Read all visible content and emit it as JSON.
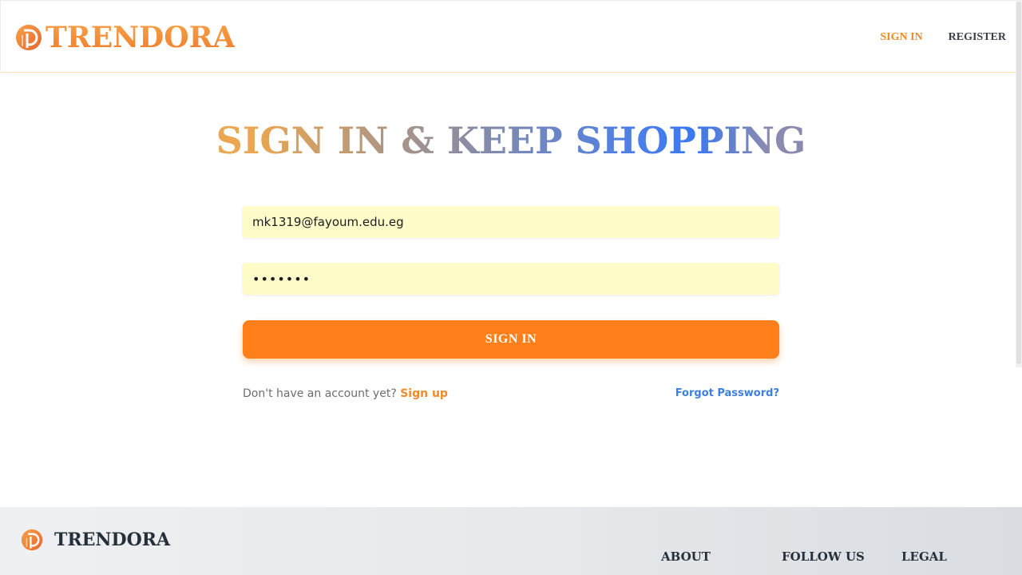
{
  "brand": {
    "name": "TRENDORA",
    "icon": "trendora-logo-icon",
    "colors": {
      "primary": "#ff7f1a",
      "accent": "#3f7fe0"
    }
  },
  "nav": {
    "sign_in": "SIGN IN",
    "register": "REGISTER"
  },
  "hero": {
    "title": "SIGN IN & KEEP SHOPPING"
  },
  "form": {
    "email_value": "mk1319@fayoum.edu.eg",
    "password_value": "•••••••",
    "submit_label": "SIGN IN",
    "signup_prompt": "Don't have an account yet?",
    "signup_link": "Sign up",
    "forgot_link": "Forgot Password?"
  },
  "footer": {
    "brand": "TRENDORA",
    "columns": [
      "ABOUT",
      "FOLLOW US",
      "LEGAL"
    ]
  }
}
